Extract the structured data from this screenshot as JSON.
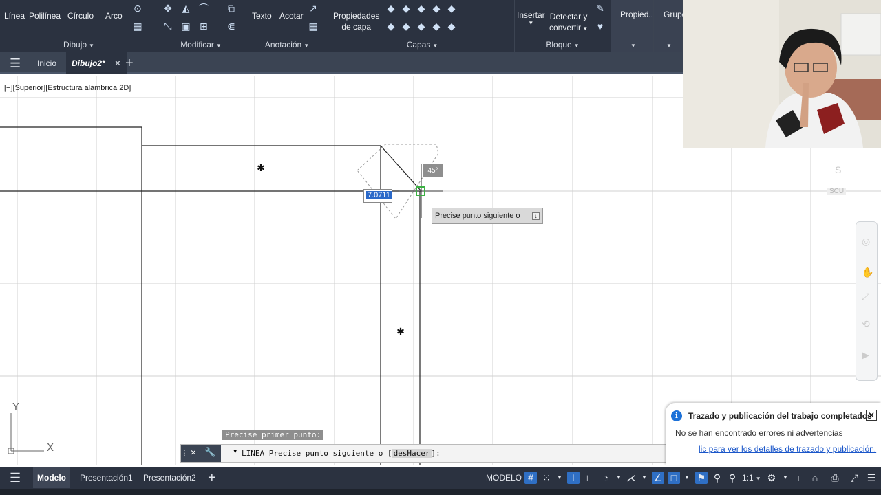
{
  "ribbon": {
    "dibujo": {
      "title": "Dibujo",
      "linea": "Línea",
      "polilinea": "Polilínea",
      "circulo": "Círculo",
      "arco": "Arco"
    },
    "modificar": {
      "title": "Modificar"
    },
    "anotacion": {
      "title": "Anotación",
      "texto": "Texto",
      "acotar": "Acotar"
    },
    "capas": {
      "title": "Capas",
      "propiedades": "Propiedades de capa",
      "propiedades_line1": "Propiedades",
      "propiedades_line2": "de capa"
    },
    "bloque": {
      "title": "Bloque",
      "insertar": "Insertar",
      "detectar_line1": "Detectar y",
      "detectar_line2": "convertir"
    },
    "propiedades": "Propied...",
    "grupos": "Grupo"
  },
  "tabs": {
    "inicio": "Inicio",
    "dibujo2": "Dibujo2*"
  },
  "viewport": {
    "label": "[−][Superior][Estructura alámbrica 2D]"
  },
  "dynamic_input": {
    "distance": "7.0711",
    "angle": "45°",
    "prompt": "Precise punto siguiente o"
  },
  "first_point_prompt": "Precise primer punto:",
  "command_line": {
    "command": "LINEA",
    "text": "Precise punto siguiente o [",
    "option": "desHacer",
    "suffix": "]:"
  },
  "notification": {
    "title": "Trazado y publicación del trabajo completados",
    "message": "No se han encontrado errores ni advertencias",
    "link": "lic para ver los detalles de trazado y publicación."
  },
  "viewcube": {
    "letter": "S",
    "ucs": "SCU"
  },
  "ucs_icon": {
    "x": "X",
    "y": "Y"
  },
  "statusbar": {
    "tabs": [
      "Modelo",
      "Presentación1",
      "Presentación2"
    ],
    "mode": "MODELO",
    "scale": "1:1"
  },
  "colors": {
    "ribbon_bg": "#2b3240",
    "accent": "#2f6fc4",
    "notify_link": "#1a56c9"
  }
}
